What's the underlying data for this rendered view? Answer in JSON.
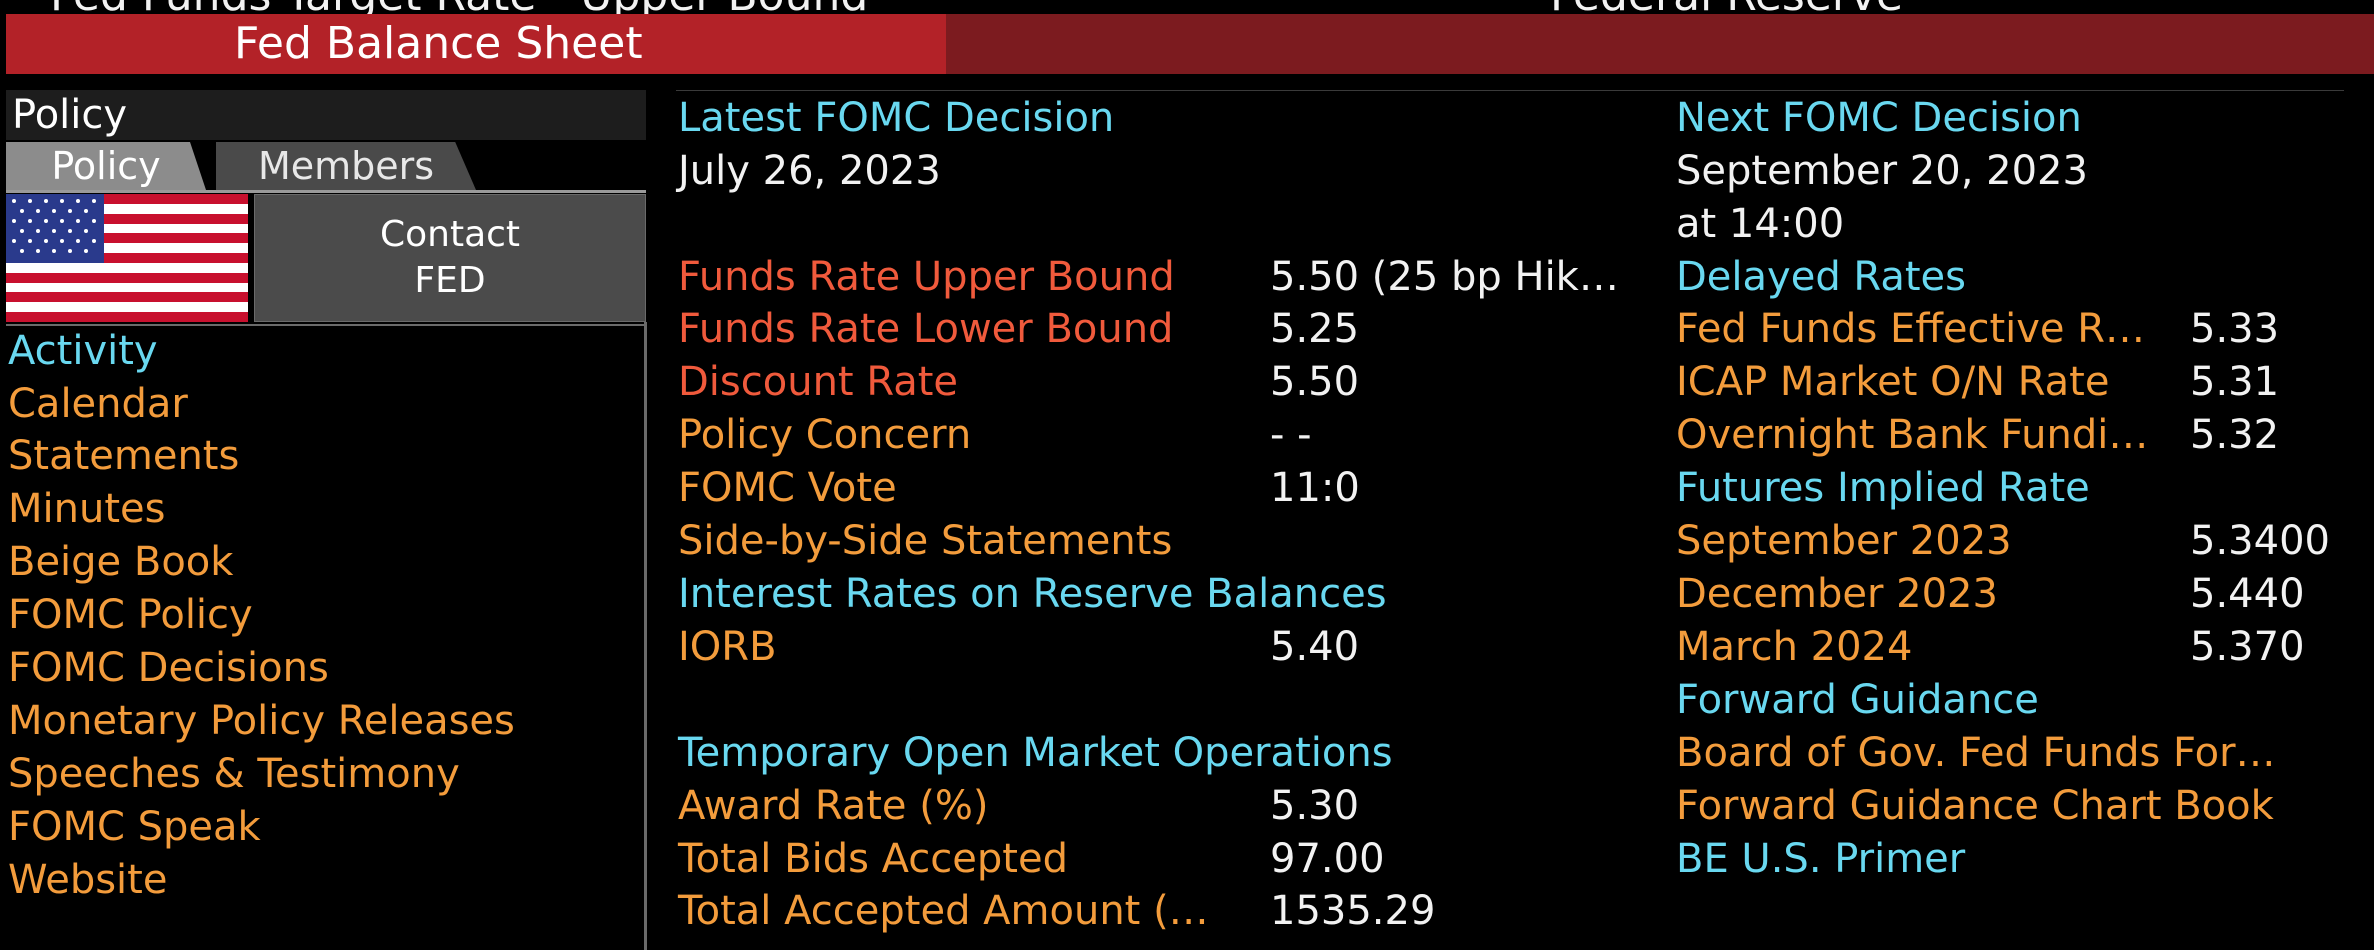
{
  "top_strip": {
    "left_text": "Fed Funds Target Rate - Upper Bound",
    "right_text": "Federal Reserve"
  },
  "header": {
    "title": "Fed Balance Sheet"
  },
  "panel": {
    "title": "Policy",
    "tabs": [
      "Policy",
      "Members"
    ],
    "contact_line1": "Contact",
    "contact_line2": "FED",
    "menu": [
      "Activity",
      "Calendar",
      "Statements",
      "Minutes",
      "Beige Book",
      "FOMC Policy",
      "FOMC Decisions",
      "Monetary Policy Releases",
      "Speeches & Testimony",
      "FOMC Speak",
      "Website"
    ]
  },
  "latest": {
    "heading": "Latest FOMC Decision",
    "date": "July 26, 2023",
    "rows": [
      {
        "label": "Funds Rate Upper Bound",
        "value": "5.50 (25 bp Hik…"
      },
      {
        "label": "Funds Rate Lower Bound",
        "value": "5.25"
      },
      {
        "label": "Discount Rate",
        "value": "5.50"
      },
      {
        "label": "Policy Concern",
        "value": "- -"
      },
      {
        "label": "FOMC Vote",
        "value": "11:0"
      }
    ],
    "side_by_side": "Side-by-Side Statements",
    "reserve_heading": "Interest Rates on Reserve Balances",
    "iorb_label": "IORB",
    "iorb_value": "5.40",
    "tomo_heading": "Temporary Open Market Operations",
    "tomo_rows": [
      {
        "label": "Award Rate (%)",
        "value": "5.30"
      },
      {
        "label": "Total Bids Accepted",
        "value": "97.00"
      },
      {
        "label": "Total Accepted Amount (…",
        "value": "1535.29"
      }
    ]
  },
  "next": {
    "heading": "Next FOMC Decision",
    "date": "September 20, 2023",
    "time": "at 14:00",
    "delayed_heading": "Delayed Rates",
    "delayed_rows": [
      {
        "label": "Fed Funds Effective R…",
        "value": "5.33"
      },
      {
        "label": "ICAP Market O/N Rate",
        "value": "5.31"
      },
      {
        "label": "Overnight Bank Fundi…",
        "value": "5.32"
      }
    ],
    "futures_heading": "Futures Implied Rate",
    "futures_rows": [
      {
        "label": "September 2023",
        "value": "5.3400"
      },
      {
        "label": "December 2023",
        "value": "5.440"
      },
      {
        "label": "March 2024",
        "value": "5.370"
      }
    ],
    "guidance_heading": "Forward Guidance",
    "guidance_items": [
      "Board of Gov. Fed Funds For…",
      "Forward Guidance Chart Book",
      "BE U.S. Primer"
    ]
  },
  "colors": {
    "header_red": "#b32228",
    "header_dark_red": "#7c1b1f",
    "label_orange": "#f39c3c",
    "label_red": "#f05a3c",
    "heading_cyan": "#69d8f0"
  }
}
